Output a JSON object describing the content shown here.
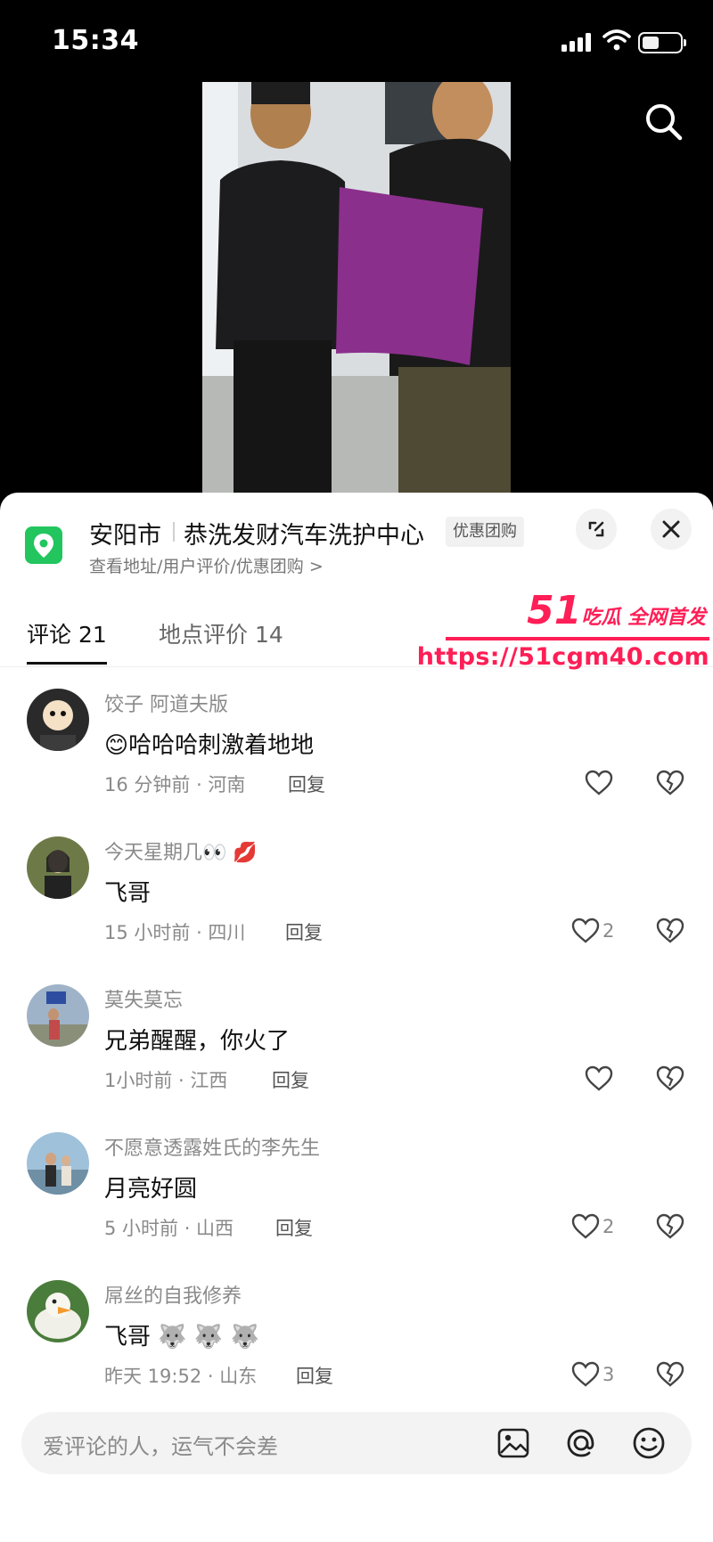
{
  "status": {
    "time": "15:34"
  },
  "location": {
    "city": "安阳市",
    "name": "恭洗发财汽车洗护中心",
    "badge": "优惠团购",
    "subtitle": "查看地址/用户评价/优惠团购 >"
  },
  "tabs": [
    {
      "label": "评论 21"
    },
    {
      "label": "地点评价 14"
    }
  ],
  "watermark": {
    "number": "51",
    "text": "吃瓜 全网首发",
    "url": "https://51cgm40.com"
  },
  "comments": [
    {
      "user": "饺子 阿道夫版",
      "text": "😊哈哈哈刺激着地地",
      "meta": "16 分钟前 · 河南",
      "reply": "回复",
      "likes": ""
    },
    {
      "user": "今天星期几👀 💋",
      "text": "飞哥",
      "meta": "15 小时前 · 四川",
      "reply": "回复",
      "likes": "2"
    },
    {
      "user": "莫失莫忘",
      "text": "兄弟醒醒，你火了",
      "meta": "1小时前 · 江西",
      "reply": "回复",
      "likes": ""
    },
    {
      "user": "不愿意透露姓氏的李先生",
      "text": "月亮好圆",
      "meta": "5 小时前 · 山西",
      "reply": "回复",
      "likes": "2"
    },
    {
      "user": "屌丝的自我修养",
      "text": "飞哥 🐺 🐺 🐺",
      "meta": "昨天 19:52 · 山东",
      "reply": "回复",
      "likes": "3"
    }
  ],
  "input": {
    "placeholder": "爱评论的人，运气不会差"
  },
  "colors": {
    "accent_green": "#22c55e",
    "watermark_red": "#ff1e56"
  }
}
